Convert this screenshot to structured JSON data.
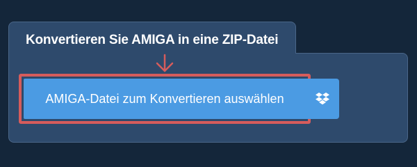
{
  "tab": {
    "title": "Konvertieren Sie AMIGA in eine ZIP-Datei"
  },
  "upload": {
    "button_label": "AMIGA-Datei zum Konvertieren auswählen",
    "dropbox_icon": "dropbox-icon",
    "arrow_icon": "arrow-down-icon"
  },
  "colors": {
    "background": "#14263a",
    "panel": "#2e4a6c",
    "button": "#4b9be3",
    "highlight": "#d65c5c"
  }
}
